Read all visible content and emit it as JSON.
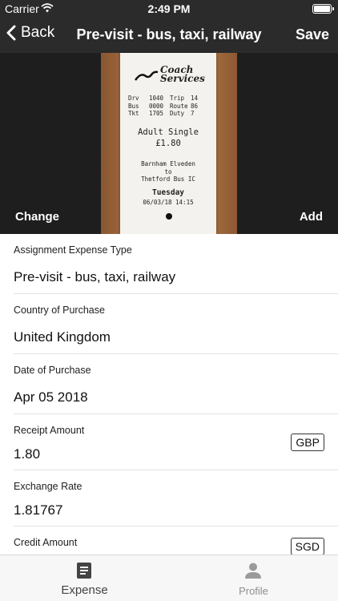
{
  "status_bar": {
    "carrier": "Carrier",
    "time": "2:49 PM"
  },
  "nav": {
    "back_label": "Back",
    "title": "Pre-visit - bus, taxi, railway",
    "save_label": "Save"
  },
  "photo": {
    "change_label": "Change",
    "add_label": "Add",
    "receipt": {
      "logo_line1": "Coach",
      "logo_line2": "Services",
      "row1": [
        "Drv",
        "1040",
        "Trip",
        "14"
      ],
      "row2": [
        "Bus",
        "0000",
        "Route",
        "86"
      ],
      "row3": [
        "Tkt",
        "1705",
        "Duty",
        "7"
      ],
      "fare_type": "Adult Single",
      "fare_amount": "£1.80",
      "route_from": "Barnham Elveden",
      "route_to_word": "to",
      "route_to": "Thetford Bus IC",
      "day": "Tuesday",
      "datetime": "06/03/18 14:15"
    }
  },
  "form": {
    "fields": [
      {
        "label": "Assignment Expense Type",
        "value": "Pre-visit - bus, taxi, railway"
      },
      {
        "label": "Country of Purchase",
        "value": "United Kingdom"
      },
      {
        "label": "Date of Purchase",
        "value": "Apr 05 2018"
      },
      {
        "label": "Receipt Amount",
        "value": "1.80",
        "currency": "GBP"
      },
      {
        "label": "Exchange Rate",
        "value": "1.81767"
      },
      {
        "label": "Credit Amount",
        "value": "",
        "currency": "SGD"
      }
    ]
  },
  "tabbar": {
    "tabs": [
      {
        "label": "Expense",
        "icon": "document-icon",
        "active": true
      },
      {
        "label": "Profile",
        "icon": "person-icon",
        "active": false
      }
    ]
  },
  "colors": {
    "nav_background": "#2b2b2b",
    "tabbar_background": "#f7f7f7",
    "separator": "#e2e2e2"
  }
}
